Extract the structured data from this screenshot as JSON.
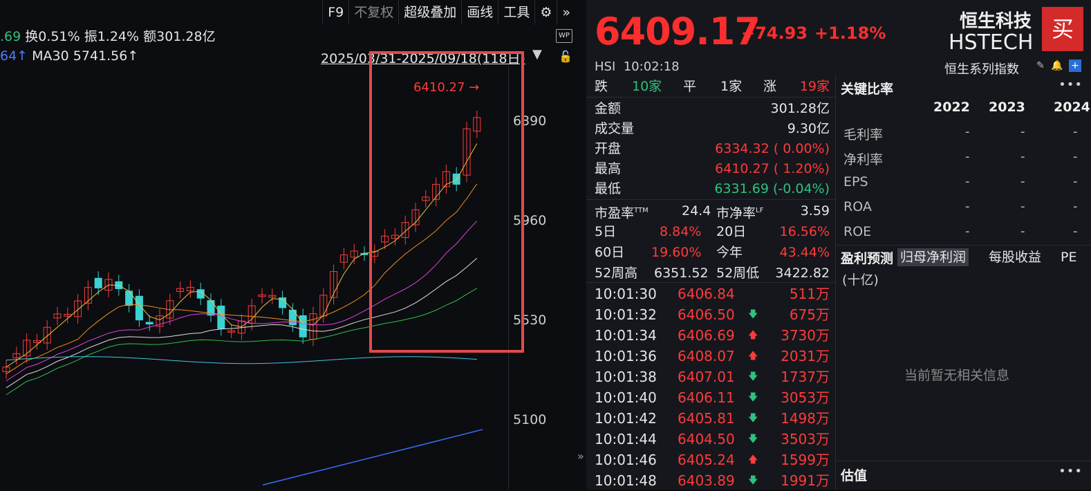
{
  "toolbar": {
    "f9": "F9",
    "fuquan": "不复权",
    "overlay": "超级叠加",
    "draw": "画线",
    "tools": "工具"
  },
  "chart_info": {
    "first_val": ".69",
    "turnover_label": "换",
    "turnover": "0.51%",
    "amplitude_label": "振",
    "amplitude": "1.24%",
    "amount_label": "额",
    "amount": "301.28亿",
    "ma_prev": "64↑",
    "ma30_label": "MA30",
    "ma30": "5741.56↑",
    "date_range": "2025/03/31-2025/09/18(118日)"
  },
  "chart_data": {
    "type": "candlestick",
    "y_ticks": [
      "6390",
      "5960",
      "5530",
      "5100"
    ],
    "high_label": "6410.27",
    "ylim": [
      4800,
      6630
    ]
  },
  "quote": {
    "price": "6409.17",
    "change": "+74.93",
    "change_pct": "+1.18%",
    "name_cn": "恒生科技",
    "name_en": "HSTECH",
    "buy_label": "买",
    "code": "HSI",
    "time": "10:02:18",
    "series": "恒生系列指数",
    "breadth": {
      "down_label": "跌",
      "down": "10家",
      "flat_label": "平",
      "flat": "1家",
      "up_label": "涨",
      "up": "19家"
    },
    "stats": [
      {
        "label": "金额",
        "value": "301.28亿",
        "color": "white"
      },
      {
        "label": "成交量",
        "value": "9.30亿",
        "color": "white"
      },
      {
        "label": "开盘",
        "value": "6334.32 ( 0.00%)",
        "color": "red"
      },
      {
        "label": "最高",
        "value": "6410.27 ( 1.20%)",
        "color": "red"
      },
      {
        "label": "最低",
        "value": "6331.69 (-0.04%)",
        "color": "green"
      }
    ],
    "pe_label": "市盈率",
    "pe_sup": "TTM",
    "pe": "24.4",
    "pb_label": "市净率",
    "pb_sup": "LF",
    "pb": "3.59",
    "perf": [
      {
        "l1": "5日",
        "v1": "8.84%",
        "l2": "20日",
        "v2": "16.56%"
      },
      {
        "l1": "60日",
        "v1": "19.60%",
        "l2": "今年",
        "v2": "43.44%"
      }
    ],
    "w52_high_label": "52周高",
    "w52_high": "6351.52",
    "w52_low_label": "52周低",
    "w52_low": "3422.82"
  },
  "ticks": [
    {
      "time": "10:01:30",
      "price": "6406.84",
      "dir": "",
      "vol": "511万"
    },
    {
      "time": "10:01:32",
      "price": "6406.50",
      "dir": "down",
      "vol": "675万"
    },
    {
      "time": "10:01:34",
      "price": "6406.69",
      "dir": "up",
      "vol": "3730万"
    },
    {
      "time": "10:01:36",
      "price": "6408.07",
      "dir": "up",
      "vol": "2031万"
    },
    {
      "time": "10:01:38",
      "price": "6407.01",
      "dir": "down",
      "vol": "1737万"
    },
    {
      "time": "10:01:40",
      "price": "6406.11",
      "dir": "down",
      "vol": "3053万"
    },
    {
      "time": "10:01:42",
      "price": "6405.81",
      "dir": "down",
      "vol": "1498万"
    },
    {
      "time": "10:01:44",
      "price": "6404.50",
      "dir": "down",
      "vol": "3503万"
    },
    {
      "time": "10:01:46",
      "price": "6405.24",
      "dir": "up",
      "vol": "1599万"
    },
    {
      "time": "10:01:48",
      "price": "6403.89",
      "dir": "down",
      "vol": "1991万"
    }
  ],
  "ratios": {
    "title": "关键比率",
    "years": [
      "2022",
      "2023",
      "2024"
    ],
    "rows": [
      {
        "label": "毛利率",
        "vals": [
          "-",
          "-",
          "-"
        ]
      },
      {
        "label": "净利率",
        "vals": [
          "-",
          "-",
          "-"
        ]
      },
      {
        "label": "EPS",
        "vals": [
          "-",
          "-",
          "-"
        ]
      },
      {
        "label": "ROA",
        "vals": [
          "-",
          "-",
          "-"
        ]
      },
      {
        "label": "ROE",
        "vals": [
          "-",
          "-",
          "-"
        ]
      }
    ]
  },
  "forecast": {
    "title": "盈利预测",
    "tabs": [
      "归母净利润",
      "每股收益",
      "PE"
    ],
    "unit": "(十亿)",
    "empty": "当前暂无相关信息"
  },
  "valuation": {
    "title": "估值"
  },
  "colors": {
    "up": "#ff3b3b",
    "down": "#2ec27e",
    "box": "#e24b4b"
  }
}
